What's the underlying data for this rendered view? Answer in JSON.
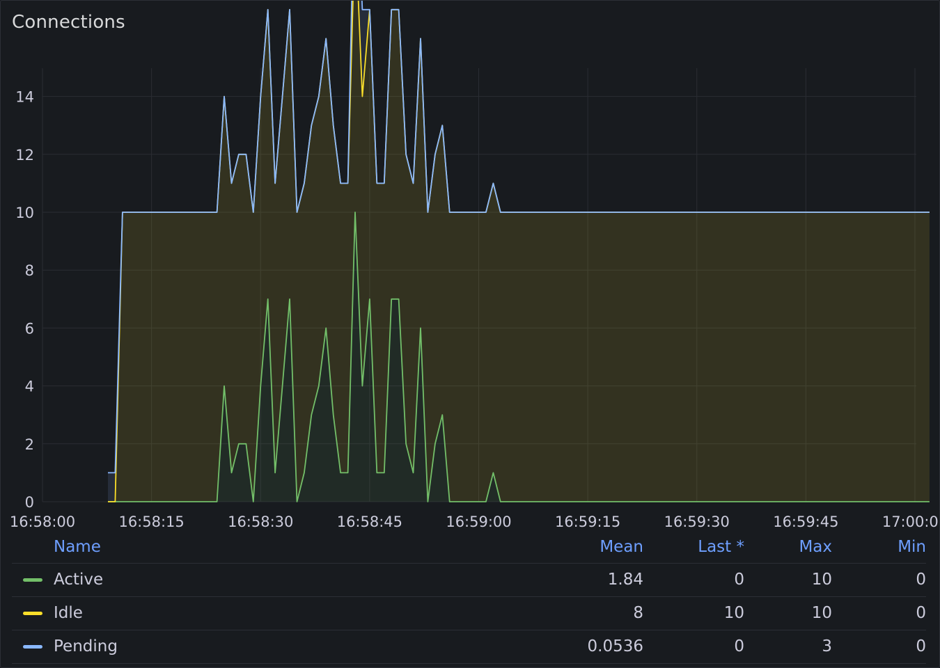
{
  "panel": {
    "title": "Connections"
  },
  "legend": {
    "headers": {
      "name": "Name",
      "mean": "Mean",
      "last": "Last *",
      "max": "Max",
      "min": "Min"
    },
    "rows": [
      {
        "name": "Active",
        "color": "#73bf69",
        "mean": "1.84",
        "last": "0",
        "max": "10",
        "min": "0"
      },
      {
        "name": "Idle",
        "color": "#fade2a",
        "mean": "8",
        "last": "10",
        "max": "10",
        "min": "0"
      },
      {
        "name": "Pending",
        "color": "#8ab8ff",
        "mean": "0.0536",
        "last": "0",
        "max": "3",
        "min": "0"
      }
    ]
  },
  "chart_data": {
    "type": "area",
    "stacked": true,
    "x_start": "16:58:00",
    "x_range_seconds": [
      0,
      62
    ],
    "ylim": [
      0,
      15
    ],
    "yticks": [
      "0",
      "2",
      "4",
      "6",
      "8",
      "10",
      "12",
      "14"
    ],
    "xticks": [
      "16:58:00",
      "16:58:15",
      "16:58:30",
      "16:58:45",
      "16:59:00",
      "16:59:15",
      "16:59:30",
      "16:59:45",
      "17:00:00"
    ],
    "grid": true,
    "legend_placement": "bottom-table",
    "x": [
      "16:58:09",
      "16:58:10",
      "16:58:11",
      "16:58:12",
      "16:58:13",
      "16:58:14",
      "16:58:15",
      "16:58:16",
      "16:58:17",
      "16:58:18",
      "16:58:19",
      "16:58:20",
      "16:58:21",
      "16:58:22",
      "16:58:23",
      "16:58:24",
      "16:58:25",
      "16:58:26",
      "16:58:27",
      "16:58:28",
      "16:58:29",
      "16:58:30",
      "16:58:31",
      "16:58:32",
      "16:58:33",
      "16:58:34",
      "16:58:35",
      "16:58:36",
      "16:58:37",
      "16:58:38",
      "16:58:39",
      "16:58:40",
      "16:58:41",
      "16:58:42",
      "16:58:43",
      "16:58:44",
      "16:58:45",
      "16:58:46",
      "16:58:47",
      "16:58:48",
      "16:58:49",
      "16:58:50",
      "16:58:51",
      "16:58:52",
      "16:58:53",
      "16:58:54",
      "16:58:55",
      "16:58:56",
      "16:58:57",
      "16:58:58",
      "16:58:59",
      "16:59:00",
      "16:59:01",
      "16:59:02",
      "16:59:03",
      "16:59:04",
      "16:59:05",
      "16:59:06",
      "16:59:07",
      "16:59:08",
      "16:59:09",
      "16:59:10",
      "16:59:11",
      "16:59:12",
      "16:59:13",
      "16:59:14",
      "16:59:15",
      "16:59:16",
      "16:59:17",
      "16:59:18",
      "16:59:19",
      "16:59:20",
      "16:59:21",
      "16:59:22",
      "16:59:23",
      "16:59:24",
      "16:59:25",
      "16:59:26",
      "16:59:27",
      "16:59:28",
      "16:59:29",
      "16:59:30",
      "16:59:31",
      "16:59:32",
      "16:59:33",
      "16:59:34",
      "16:59:35",
      "16:59:36",
      "16:59:37",
      "16:59:38",
      "16:59:39",
      "16:59:40",
      "16:59:41",
      "16:59:42",
      "16:59:43",
      "16:59:44",
      "16:59:45",
      "16:59:46",
      "16:59:47",
      "16:59:48",
      "16:59:49",
      "16:59:50",
      "16:59:51",
      "16:59:52",
      "16:59:53",
      "16:59:54",
      "16:59:55",
      "16:59:56",
      "16:59:57",
      "16:59:58",
      "16:59:59",
      "17:00:00",
      "17:00:01",
      "17:00:02"
    ],
    "series": [
      {
        "name": "Active",
        "color": "#73bf69",
        "values": [
          0,
          0,
          0,
          0,
          0,
          0,
          0,
          0,
          0,
          0,
          0,
          0,
          0,
          0,
          0,
          0,
          4,
          1,
          2,
          2,
          0,
          4,
          7,
          1,
          4,
          7,
          0,
          1,
          3,
          4,
          6,
          3,
          1,
          1,
          10,
          4,
          7,
          1,
          1,
          7,
          7,
          2,
          1,
          6,
          0,
          2,
          3,
          0,
          0,
          0,
          0,
          0,
          0,
          1,
          0,
          0,
          0,
          0,
          0,
          0,
          0,
          0,
          0,
          0,
          0,
          0,
          0,
          0,
          0,
          0,
          0,
          0,
          0,
          0,
          0,
          0,
          0,
          0,
          0,
          0,
          0,
          0,
          0,
          0,
          0,
          0,
          0,
          0,
          0,
          0,
          0,
          0,
          0,
          0,
          0,
          0,
          0,
          0,
          0,
          0,
          0,
          0,
          0,
          0,
          0,
          0,
          0,
          0,
          0,
          0,
          0,
          0,
          0,
          0
        ]
      },
      {
        "name": "Idle",
        "color": "#fade2a",
        "values": [
          0,
          0,
          10,
          10,
          10,
          10,
          10,
          10,
          10,
          10,
          10,
          10,
          10,
          10,
          10,
          10,
          10,
          10,
          10,
          10,
          10,
          10,
          10,
          10,
          10,
          10,
          10,
          10,
          10,
          10,
          10,
          10,
          10,
          10,
          10,
          10,
          10,
          10,
          10,
          10,
          10,
          10,
          10,
          10,
          10,
          10,
          10,
          10,
          10,
          10,
          10,
          10,
          10,
          10,
          10,
          10,
          10,
          10,
          10,
          10,
          10,
          10,
          10,
          10,
          10,
          10,
          10,
          10,
          10,
          10,
          10,
          10,
          10,
          10,
          10,
          10,
          10,
          10,
          10,
          10,
          10,
          10,
          10,
          10,
          10,
          10,
          10,
          10,
          10,
          10,
          10,
          10,
          10,
          10,
          10,
          10,
          10,
          10,
          10,
          10,
          10,
          10,
          10,
          10,
          10,
          10,
          10,
          10,
          10,
          10,
          10,
          10,
          10,
          10
        ]
      },
      {
        "name": "Pending",
        "color": "#8ab8ff",
        "values": [
          1,
          1,
          0,
          0,
          0,
          0,
          0,
          0,
          0,
          0,
          0,
          0,
          0,
          0,
          0,
          0,
          0,
          0,
          0,
          0,
          0,
          0,
          0,
          0,
          0,
          0,
          0,
          0,
          0,
          0,
          0,
          0,
          0,
          0,
          3,
          3,
          0,
          0,
          0,
          0,
          0,
          0,
          0,
          0,
          0,
          0,
          0,
          0,
          0,
          0,
          0,
          0,
          0,
          0,
          0,
          0,
          0,
          0,
          0,
          0,
          0,
          0,
          0,
          0,
          0,
          0,
          0,
          0,
          0,
          0,
          0,
          0,
          0,
          0,
          0,
          0,
          0,
          0,
          0,
          0,
          0,
          0,
          0,
          0,
          0,
          0,
          0,
          0,
          0,
          0,
          0,
          0,
          0,
          0,
          0,
          0,
          0,
          0,
          0,
          0,
          0,
          0,
          0,
          0,
          0,
          0,
          0,
          0,
          0,
          0,
          0,
          0,
          0,
          0
        ]
      }
    ]
  }
}
